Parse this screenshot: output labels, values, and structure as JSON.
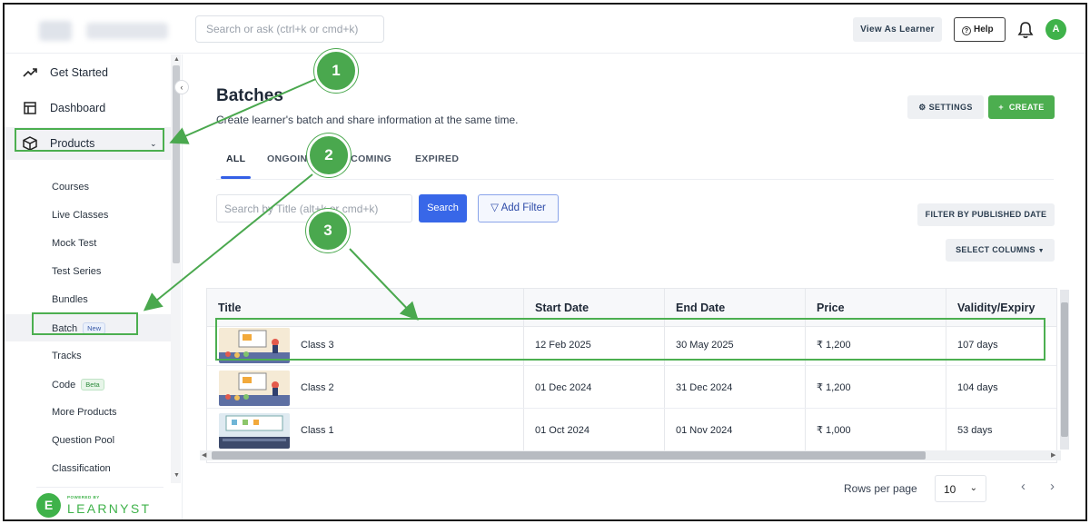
{
  "topbar": {
    "search_placeholder": "Search or ask (ctrl+k or cmd+k)",
    "view_as_learner": "View As Learner",
    "help": "Help",
    "avatar_initial": "A"
  },
  "sidebar": {
    "items": [
      {
        "label": "Get Started",
        "icon": "trending-up-icon"
      },
      {
        "label": "Dashboard",
        "icon": "dashboard-icon"
      },
      {
        "label": "Products",
        "icon": "box-icon"
      }
    ],
    "sub_items": [
      {
        "label": "Courses"
      },
      {
        "label": "Live Classes"
      },
      {
        "label": "Mock Test"
      },
      {
        "label": "Test Series"
      },
      {
        "label": "Bundles"
      },
      {
        "label": "Batch",
        "badge": "New"
      },
      {
        "label": "Tracks"
      },
      {
        "label": "Code",
        "badge": "Beta"
      },
      {
        "label": "More Products"
      },
      {
        "label": "Question Pool"
      },
      {
        "label": "Classification"
      }
    ],
    "powered_by": "POWERED BY",
    "brand": "LEARNYST",
    "brand_mark": "E"
  },
  "main": {
    "title": "Batches",
    "subtitle": "Create learner's batch and share information at the same time.",
    "settings_label": "SETTINGS",
    "create_label": "CREATE",
    "tabs": [
      {
        "label": "ALL",
        "active": true
      },
      {
        "label": "ONGOING"
      },
      {
        "label": "UPCOMING"
      },
      {
        "label": "EXPIRED"
      }
    ],
    "search_placeholder": "Search by Title (alt+k or cmd+k)",
    "search_button": "Search",
    "add_filter": "Add Filter",
    "filter_pub_date": "FILTER BY PUBLISHED DATE",
    "select_columns": "SELECT COLUMNS"
  },
  "table": {
    "columns": [
      "Title",
      "Start Date",
      "End Date",
      "Price",
      "Validity/Expiry"
    ],
    "rows": [
      {
        "title": "Class 3",
        "start": "12 Feb 2025",
        "end": "30 May 2025",
        "price": "₹ 1,200",
        "validity": "107 days"
      },
      {
        "title": "Class 2",
        "start": "01 Dec 2024",
        "end": "31 Dec 2024",
        "price": "₹ 1,200",
        "validity": "104 days"
      },
      {
        "title": "Class 1",
        "start": "01 Oct 2024",
        "end": "01 Nov 2024",
        "price": "₹ 1,000",
        "validity": "53 days"
      }
    ]
  },
  "pagination": {
    "rows_per_page_label": "Rows per page",
    "rows_per_page_value": "10"
  },
  "annotations": {
    "step1": "1",
    "step2": "2",
    "step3": "3",
    "color": "#4aa84e"
  },
  "colors": {
    "accent_green": "#4cae4f",
    "primary_blue": "#3867e8"
  }
}
